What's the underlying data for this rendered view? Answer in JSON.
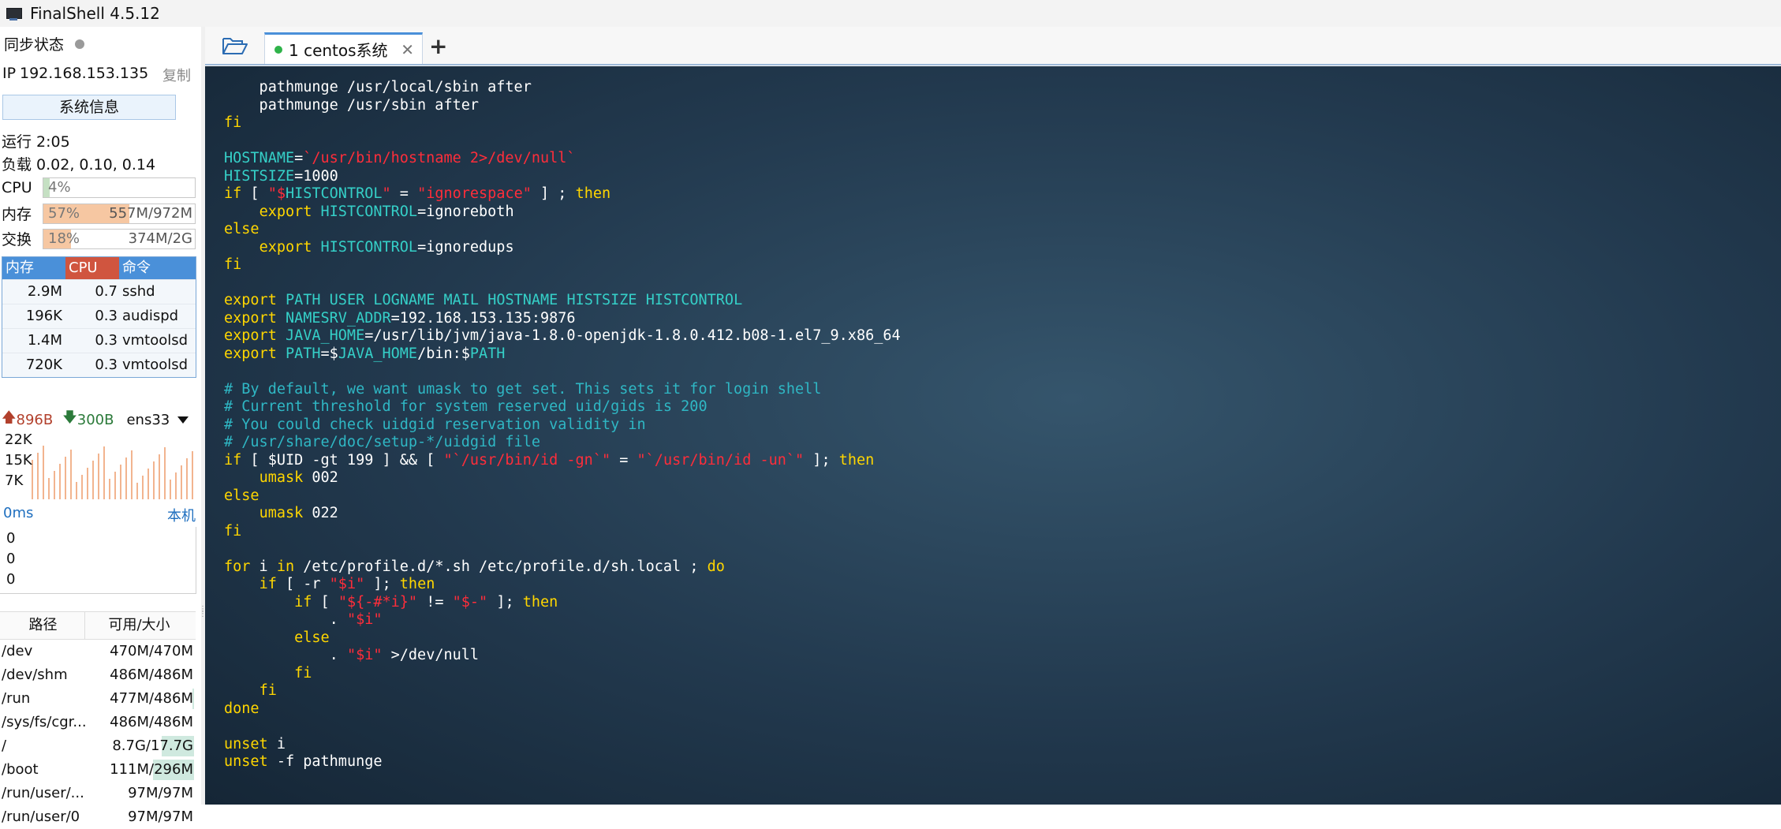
{
  "app": {
    "title": "FinalShell 4.5.12"
  },
  "sidebar": {
    "sync_label": "同步状态",
    "ip_label": "IP",
    "ip_value": "192.168.153.135",
    "copy_label": "复制",
    "sysinfo_button": "系统信息",
    "uptime": "运行 2:05",
    "load": "负载 0.02, 0.10, 0.14",
    "cpu": {
      "label": "CPU",
      "percent": "4%",
      "fraction": 0.04,
      "color": "#c5e0c3"
    },
    "mem": {
      "label": "内存",
      "percent": "57%",
      "amount": "557M/972M",
      "fraction": 0.57,
      "color": "#f6c7a2"
    },
    "swap": {
      "label": "交换",
      "percent": "18%",
      "amount": "374M/2G",
      "fraction": 0.18,
      "color": "#f6c7a2"
    },
    "proc_headers": {
      "mem": "内存",
      "cpu": "CPU",
      "cmd": "命令"
    },
    "proc_header_colors": {
      "mem": "#4a90d9",
      "cpu": "#d0553f",
      "cmd": "#4a90d9"
    },
    "processes": [
      {
        "mem": "2.9M",
        "cpu": "0.7",
        "cmd": "sshd"
      },
      {
        "mem": "196K",
        "cpu": "0.3",
        "cmd": "audispd"
      },
      {
        "mem": "1.4M",
        "cpu": "0.3",
        "cmd": "vmtoolsd"
      },
      {
        "mem": "720K",
        "cpu": "0.3",
        "cmd": "vmtoolsd"
      }
    ],
    "net": {
      "up": "896B",
      "down": "300B",
      "iface": "ens33",
      "axis": [
        "22K",
        "15K",
        "7K"
      ]
    },
    "latency": {
      "ms": "0ms",
      "host": "本机",
      "values": [
        "0",
        "0",
        "0"
      ]
    },
    "disk_headers": {
      "path": "路径",
      "size": "可用/大小"
    },
    "disks": [
      {
        "path": "/dev",
        "size": "470M/470M",
        "used": 0.0
      },
      {
        "path": "/dev/shm",
        "size": "486M/486M",
        "used": 0.0
      },
      {
        "path": "/run",
        "size": "477M/486M",
        "used": 0.02
      },
      {
        "path": "/sys/fs/cgr...",
        "size": "486M/486M",
        "used": 0.0
      },
      {
        "path": "/",
        "size": "8.7G/17.7G",
        "used": 0.49
      },
      {
        "path": "/boot",
        "size": "111M/296M",
        "used": 0.62
      },
      {
        "path": "/run/user/...",
        "size": "97M/97M",
        "used": 0.0
      },
      {
        "path": "/run/user/0",
        "size": "97M/97M",
        "used": 0.0
      }
    ]
  },
  "tabs": [
    {
      "label": "1  centos系统"
    }
  ],
  "terminal": {
    "lines": [
      "    pathmunge /usr/local/sbin after",
      "    pathmunge /usr/sbin after",
      "fi",
      "",
      "HOSTNAME=`/usr/bin/hostname 2>/dev/null`",
      "HISTSIZE=1000",
      "if [ \"$HISTCONTROL\" = \"ignorespace\" ] ; then",
      "    export HISTCONTROL=ignoreboth",
      "else",
      "    export HISTCONTROL=ignoredups",
      "fi",
      "",
      "export PATH USER LOGNAME MAIL HOSTNAME HISTSIZE HISTCONTROL",
      "export NAMESRV_ADDR=192.168.153.135:9876",
      "export JAVA_HOME=/usr/lib/jvm/java-1.8.0-openjdk-1.8.0.412.b08-1.el7_9.x86_64",
      "export PATH=$JAVA_HOME/bin:$PATH",
      "",
      "# By default, we want umask to get set. This sets it for login shell",
      "# Current threshold for system reserved uid/gids is 200",
      "# You could check uidgid reservation validity in",
      "# /usr/share/doc/setup-*/uidgid file",
      "if [ $UID -gt 199 ] && [ \"`/usr/bin/id -gn`\" = \"`/usr/bin/id -un`\" ]; then",
      "    umask 002",
      "else",
      "    umask 022",
      "fi",
      "",
      "for i in /etc/profile.d/*.sh /etc/profile.d/sh.local ; do",
      "    if [ -r \"$i\" ]; then",
      "        if [ \"${-#*i}\" != \"$-\" ]; then",
      "            . \"$i\"",
      "        else",
      "            . \"$i\" >/dev/null",
      "        fi",
      "    fi",
      "done",
      "",
      "unset i",
      "unset -f pathmunge"
    ]
  }
}
